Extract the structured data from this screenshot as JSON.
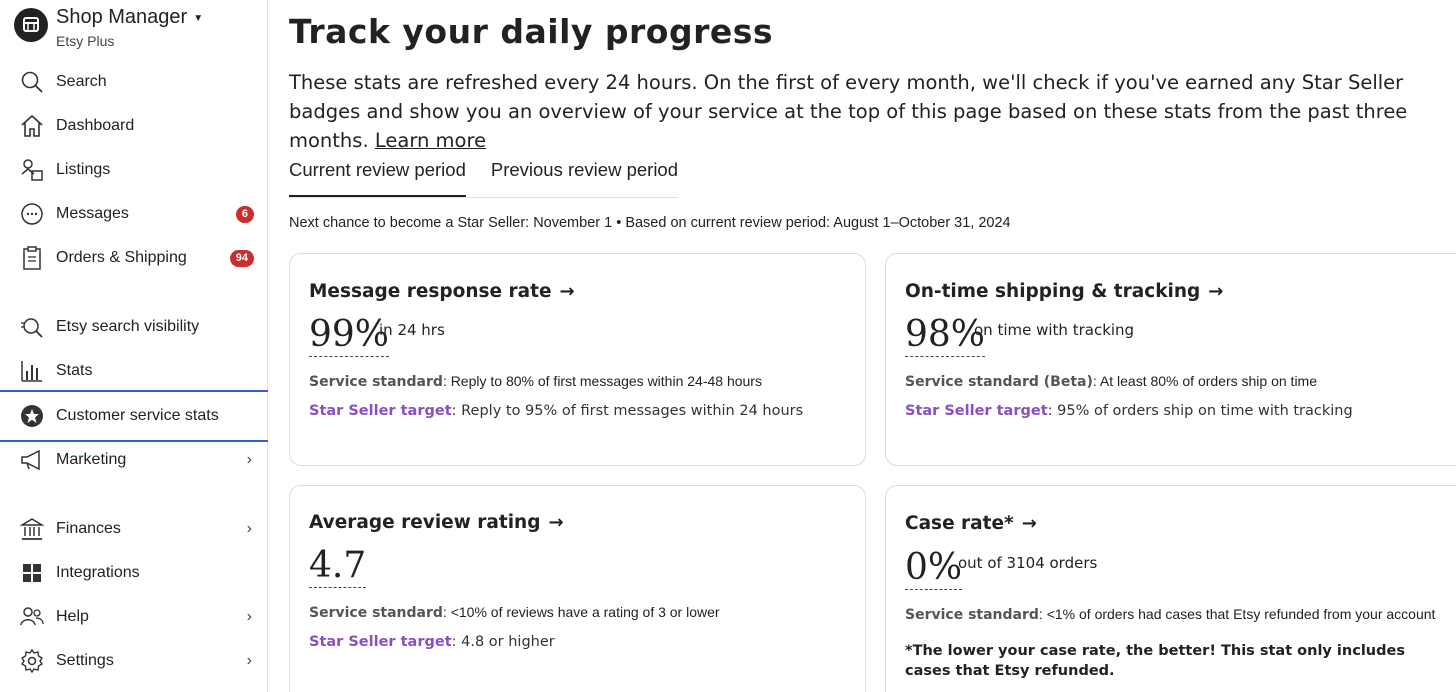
{
  "sidebar": {
    "brand": {
      "title": "Shop Manager",
      "subtitle": "Etsy Plus",
      "logo_icon": "etsy-shop-icon"
    },
    "items": [
      {
        "label": "Search",
        "icon": "search-icon"
      },
      {
        "label": "Dashboard",
        "icon": "home-icon"
      },
      {
        "label": "Listings",
        "icon": "listings-icon"
      },
      {
        "label": "Messages",
        "icon": "messages-icon",
        "badge": "6"
      },
      {
        "label": "Orders & Shipping",
        "icon": "clipboard-icon",
        "badge": "94"
      },
      {
        "label": "Etsy search visibility",
        "icon": "search-visibility-icon"
      },
      {
        "label": "Stats",
        "icon": "bar-chart-icon"
      },
      {
        "label": "Customer service stats",
        "icon": "star-badge-icon",
        "active": true
      },
      {
        "label": "Marketing",
        "icon": "megaphone-icon",
        "chevron": true
      },
      {
        "label": "Finances",
        "icon": "bank-icon",
        "chevron": true
      },
      {
        "label": "Integrations",
        "icon": "grid-icon"
      },
      {
        "label": "Help",
        "icon": "help-people-icon",
        "chevron": true
      },
      {
        "label": "Settings",
        "icon": "gear-icon",
        "chevron": true
      }
    ]
  },
  "main": {
    "title": "Track your daily progress",
    "intro": "These stats are refreshed every 24 hours. On the first of every month, we'll check if you've earned any Star Seller badges and show you an overview of your service at the top of this page based on these stats from the past three months.",
    "learn_more": "Learn more",
    "tabs": [
      {
        "label": "Current review period",
        "active": true
      },
      {
        "label": "Previous review period"
      }
    ],
    "period_text": "Next chance to become a Star Seller: November 1 • Based on current review period: August 1–October 31, 2024",
    "cards": [
      {
        "title": "Message response rate",
        "value": "99%",
        "value_sub": "in 24 hrs",
        "standard_label": "Service standard",
        "standard_text": ": Reply to 80% of first messages within 24-48 hours",
        "target_label": "Star Seller target",
        "target_text": ": Reply to 95% of first messages within 24 hours"
      },
      {
        "title": "On-time shipping & tracking",
        "value": "98%",
        "value_sub": "on time with tracking",
        "standard_label": "Service standard (Beta)",
        "standard_text": ": At least 80% of orders ship on time",
        "target_label": "Star Seller target",
        "target_text": ": 95% of orders ship on time with tracking"
      },
      {
        "title": "Average review rating",
        "value": "4.7",
        "standard_label": "Service standard",
        "standard_text": ": <10% of reviews have a rating of 3 or lower",
        "target_label": "Star Seller target",
        "target_text": ": 4.8 or higher"
      },
      {
        "title": "Case rate*",
        "value": "0%",
        "value_sub": "out of 3104 orders",
        "standard_label": "Service standard",
        "standard_text": ": <1% of orders had cases that Etsy refunded from your account",
        "note": "*The lower your case rate, the better! This stat only includes cases that Etsy refunded."
      }
    ],
    "arrow_glyph": "→"
  },
  "colors": {
    "accent_active": "#2f64c5",
    "badge": "#c9302c",
    "target_label": "#8a4fc1"
  }
}
